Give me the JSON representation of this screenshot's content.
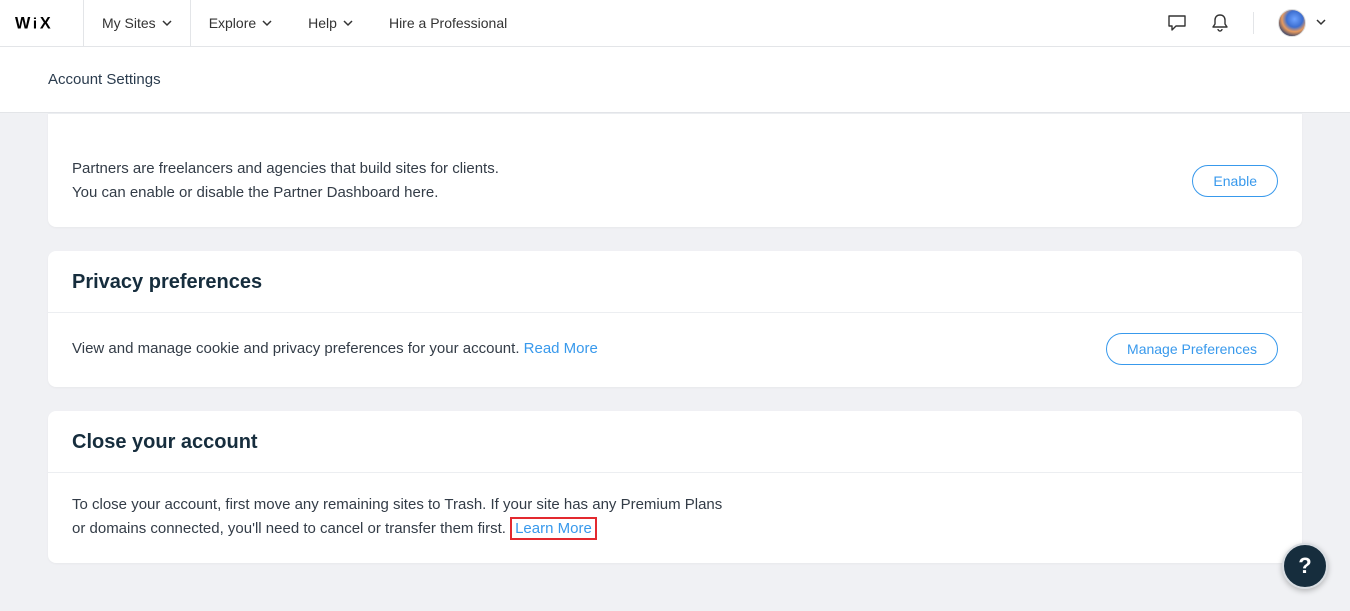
{
  "nav": {
    "mySites": "My Sites",
    "explore": "Explore",
    "help": "Help",
    "hirePro": "Hire a Professional"
  },
  "subheader": {
    "title": "Account Settings"
  },
  "partner": {
    "line1": "Partners are freelancers and agencies that build sites for clients.",
    "line2": "You can enable or disable the Partner Dashboard here.",
    "button": "Enable"
  },
  "privacy": {
    "heading": "Privacy preferences",
    "text": "View and manage cookie and privacy preferences for your account. ",
    "readMore": "Read More",
    "button": "Manage Preferences"
  },
  "closeAccount": {
    "heading": "Close your account",
    "text1": "To close your account, first move any remaining sites to Trash. If your site has any Premium Plans",
    "text2": "or domains connected, you'll need to cancel or transfer them first. ",
    "learnMore": "Learn More"
  },
  "helpFab": "?"
}
